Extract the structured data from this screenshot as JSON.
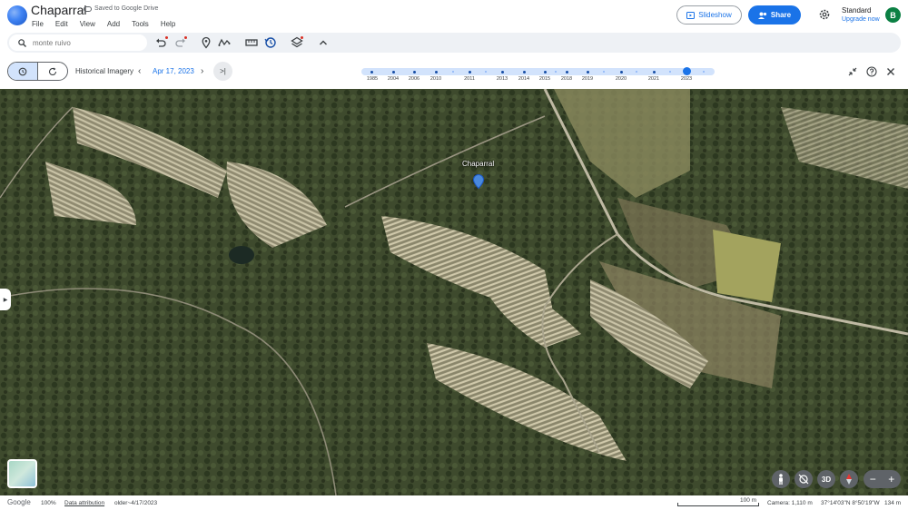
{
  "app": {
    "document_title": "Chaparral",
    "saved_status": "Saved to Google Drive",
    "menu": [
      "File",
      "Edit",
      "View",
      "Add",
      "Tools",
      "Help"
    ],
    "slideshow_label": "Slideshow",
    "share_label": "Share",
    "plan_name": "Standard",
    "upgrade_label": "Upgrade now",
    "avatar_initial": "B",
    "accent_color": "#1a73e8"
  },
  "toolbar": {
    "search_placeholder": "monte ruivo",
    "icons": [
      "undo-icon",
      "redo-icon",
      "placemark-icon",
      "path-icon",
      "measure-icon",
      "historical-imagery-icon",
      "layers-icon",
      "collapse-icon"
    ]
  },
  "history": {
    "label": "Historical Imagery",
    "current_date": "Apr 17, 2023",
    "years": [
      "1985",
      "2004",
      "2006",
      "2010",
      "2011",
      "2013",
      "2014",
      "2015",
      "2018",
      "2019",
      "2020",
      "2021",
      "2023"
    ],
    "selected_year": "2023"
  },
  "map": {
    "place_label": "Chaparral"
  },
  "status": {
    "brand": "Google",
    "zoom": "100%",
    "attribution": "Data attribution",
    "imagery_date": "older~4/17/2023",
    "scale": "100 m",
    "camera": "Camera: 1,110 m",
    "coordinates": "37°14'03\"N 8°50'19\"W",
    "elevation": "134 m"
  },
  "controls": {
    "three_d_label": "3D"
  }
}
